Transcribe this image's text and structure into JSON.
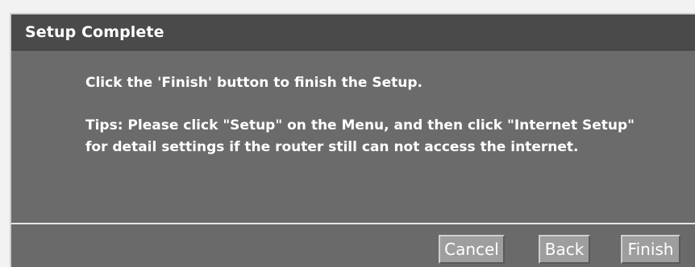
{
  "dialog": {
    "title": "Setup Complete",
    "message": "Click the 'Finish' button to finish the Setup.",
    "tips": "Tips: Please click \"Setup\" on the Menu, and then click \"Internet Setup\" for detail settings if the router still can not access the internet."
  },
  "buttons": {
    "cancel": "Cancel",
    "back": "Back",
    "finish": "Finish"
  },
  "colors": {
    "titlebar": "#4a4a4a",
    "panel": "#6b6b6b",
    "button": "#9e9e9e",
    "text": "#ffffff"
  }
}
